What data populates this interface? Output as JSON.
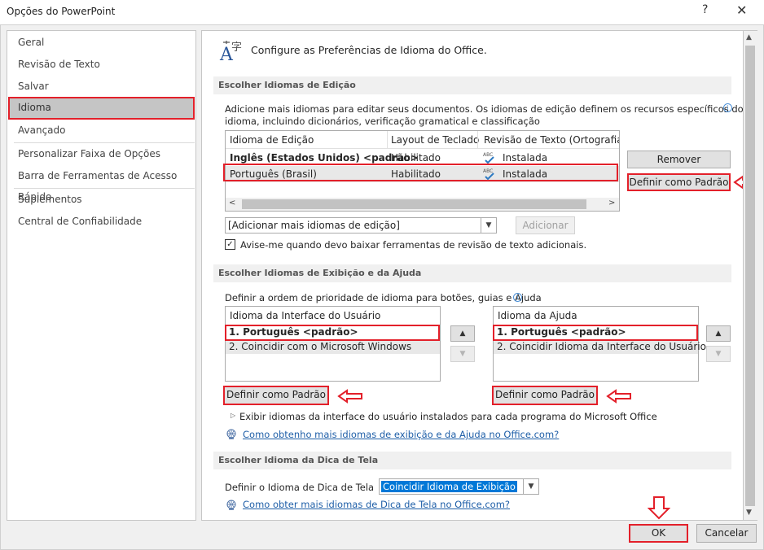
{
  "window": {
    "title": "Opções do PowerPoint",
    "help": "?",
    "close": "✕"
  },
  "sidebar": {
    "items": [
      {
        "label": "Geral"
      },
      {
        "label": "Revisão de Texto"
      },
      {
        "label": "Salvar"
      },
      {
        "label": "Idioma",
        "selected": true
      },
      {
        "label": "Avançado"
      },
      {
        "label": "Personalizar Faixa de Opções"
      },
      {
        "label": "Barra de Ferramentas de Acesso Rápido"
      },
      {
        "label": "Suplementos"
      },
      {
        "label": "Central de Confiabilidade"
      }
    ]
  },
  "header": {
    "icon": "language-icon",
    "text": "Configure as Preferências de Idioma do Office."
  },
  "editing": {
    "section_title": "Escolher Idiomas de Edição",
    "description_line1": "Adicione mais idiomas para editar seus documentos. Os idiomas de edição definem os recursos específicos do",
    "description_line2": "idioma, incluindo dicionários, verificação gramatical e classificação",
    "columns": [
      "Idioma de Edição",
      "Layout de Teclado",
      "Revisão de Texto (Ortografia, Gr"
    ],
    "rows": [
      {
        "language": "Inglês (Estados Unidos) <padrão>",
        "keyboard": "Habilitado",
        "proofing": "Instalada"
      },
      {
        "language": "Português (Brasil)",
        "keyboard": "Habilitado",
        "proofing": "Instalada"
      }
    ],
    "remove_button": "Remover",
    "set_default_button": "Definir como Padrão",
    "add_select_value": "[Adicionar mais idiomas de edição]",
    "add_button": "Adicionar",
    "notify_checkbox": "Avise-me quando devo baixar ferramentas de revisão de texto adicionais.",
    "notify_checked": true
  },
  "display": {
    "section_title": "Escolher Idiomas de Exibição e da Ajuda",
    "description": "Definir a ordem de prioridade de idioma para botões, guias e Ajuda",
    "ui_list": {
      "header": "Idioma da Interface do Usuário",
      "items": [
        "1.    Português <padrão>",
        "2.    Coincidir com o Microsoft Windows"
      ]
    },
    "help_list": {
      "header": "Idioma da Ajuda",
      "items": [
        "1.    Português <padrão>",
        "2.    Coincidir Idioma da Interface do Usuário"
      ]
    },
    "set_default_button": "Definir como Padrão",
    "expand_text": "Exibir idiomas da interface do usuário instalados para cada programa do Microsoft Office",
    "link": "Como obtenho mais idiomas de exibição e da Ajuda no Office.com?"
  },
  "tooltip": {
    "section_title": "Escolher Idioma da Dica de Tela",
    "label": "Definir o Idioma de Dica de Tela",
    "select_value": "Coincidir Idioma de Exibição",
    "link": "Como obter mais idiomas de Dica de Tela no Office.com?"
  },
  "footer": {
    "ok": "OK",
    "cancel": "Cancelar"
  },
  "colors": {
    "highlight": "#e3202a",
    "link": "#1f5fa8",
    "selection": "#0078d7"
  }
}
